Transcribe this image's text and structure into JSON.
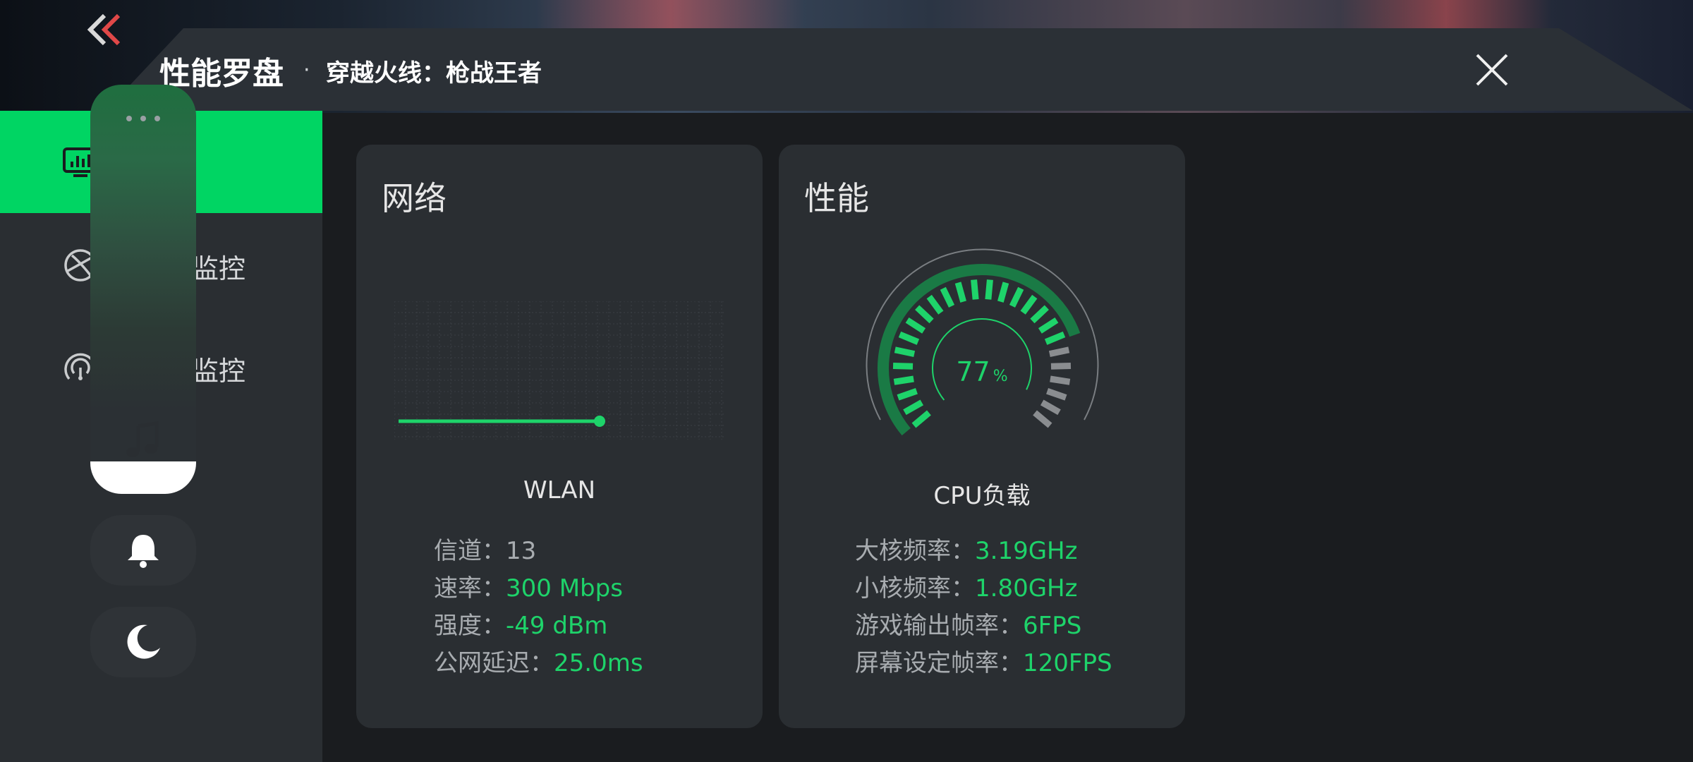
{
  "header": {
    "title": "性能罗盘",
    "separator": "·",
    "game": "穿越火线：枪战王者",
    "close_icon": "close-icon",
    "back_icon": "back-chevrons-icon"
  },
  "sidebar": {
    "items": [
      {
        "label": "",
        "icon": "monitor-chart-icon",
        "active": true
      },
      {
        "label": "监控",
        "icon": "network-globe-icon",
        "active": false
      },
      {
        "label": "监控",
        "icon": "performance-gauge-icon",
        "active": false
      }
    ]
  },
  "float_panel": {
    "more_icon": "more-dots-icon",
    "music_icon": "music-note-icon",
    "bell_icon": "bell-icon",
    "moon_icon": "moon-icon"
  },
  "network": {
    "title": "网络",
    "metric": "WLAN",
    "stats": [
      {
        "label": "信道：",
        "value": "13",
        "highlight": false
      },
      {
        "label": "速率：",
        "value": "300 Mbps",
        "highlight": true
      },
      {
        "label": "强度：",
        "value": "-49 dBm",
        "highlight": true
      },
      {
        "label": "公网延迟：",
        "value": "25.0ms",
        "highlight": true
      }
    ]
  },
  "performance": {
    "title": "性能",
    "metric": "CPU负载",
    "cpu_load_value": "77",
    "cpu_load_unit": "%",
    "cpu_load_fraction": 0.77,
    "stats": [
      {
        "label": "大核频率：",
        "value": "3.19GHz"
      },
      {
        "label": "小核频率：",
        "value": "1.80GHz"
      },
      {
        "label": "游戏输出帧率：",
        "value": "6FPS"
      },
      {
        "label": "屏幕设定帧率：",
        "value": "120FPS"
      }
    ]
  },
  "colors": {
    "accent": "#00d563",
    "accent_text": "#1ed36a",
    "card_bg": "#2a2e32",
    "page_bg": "#1a1c1f",
    "gauge_inactive": "#8a8d90"
  }
}
